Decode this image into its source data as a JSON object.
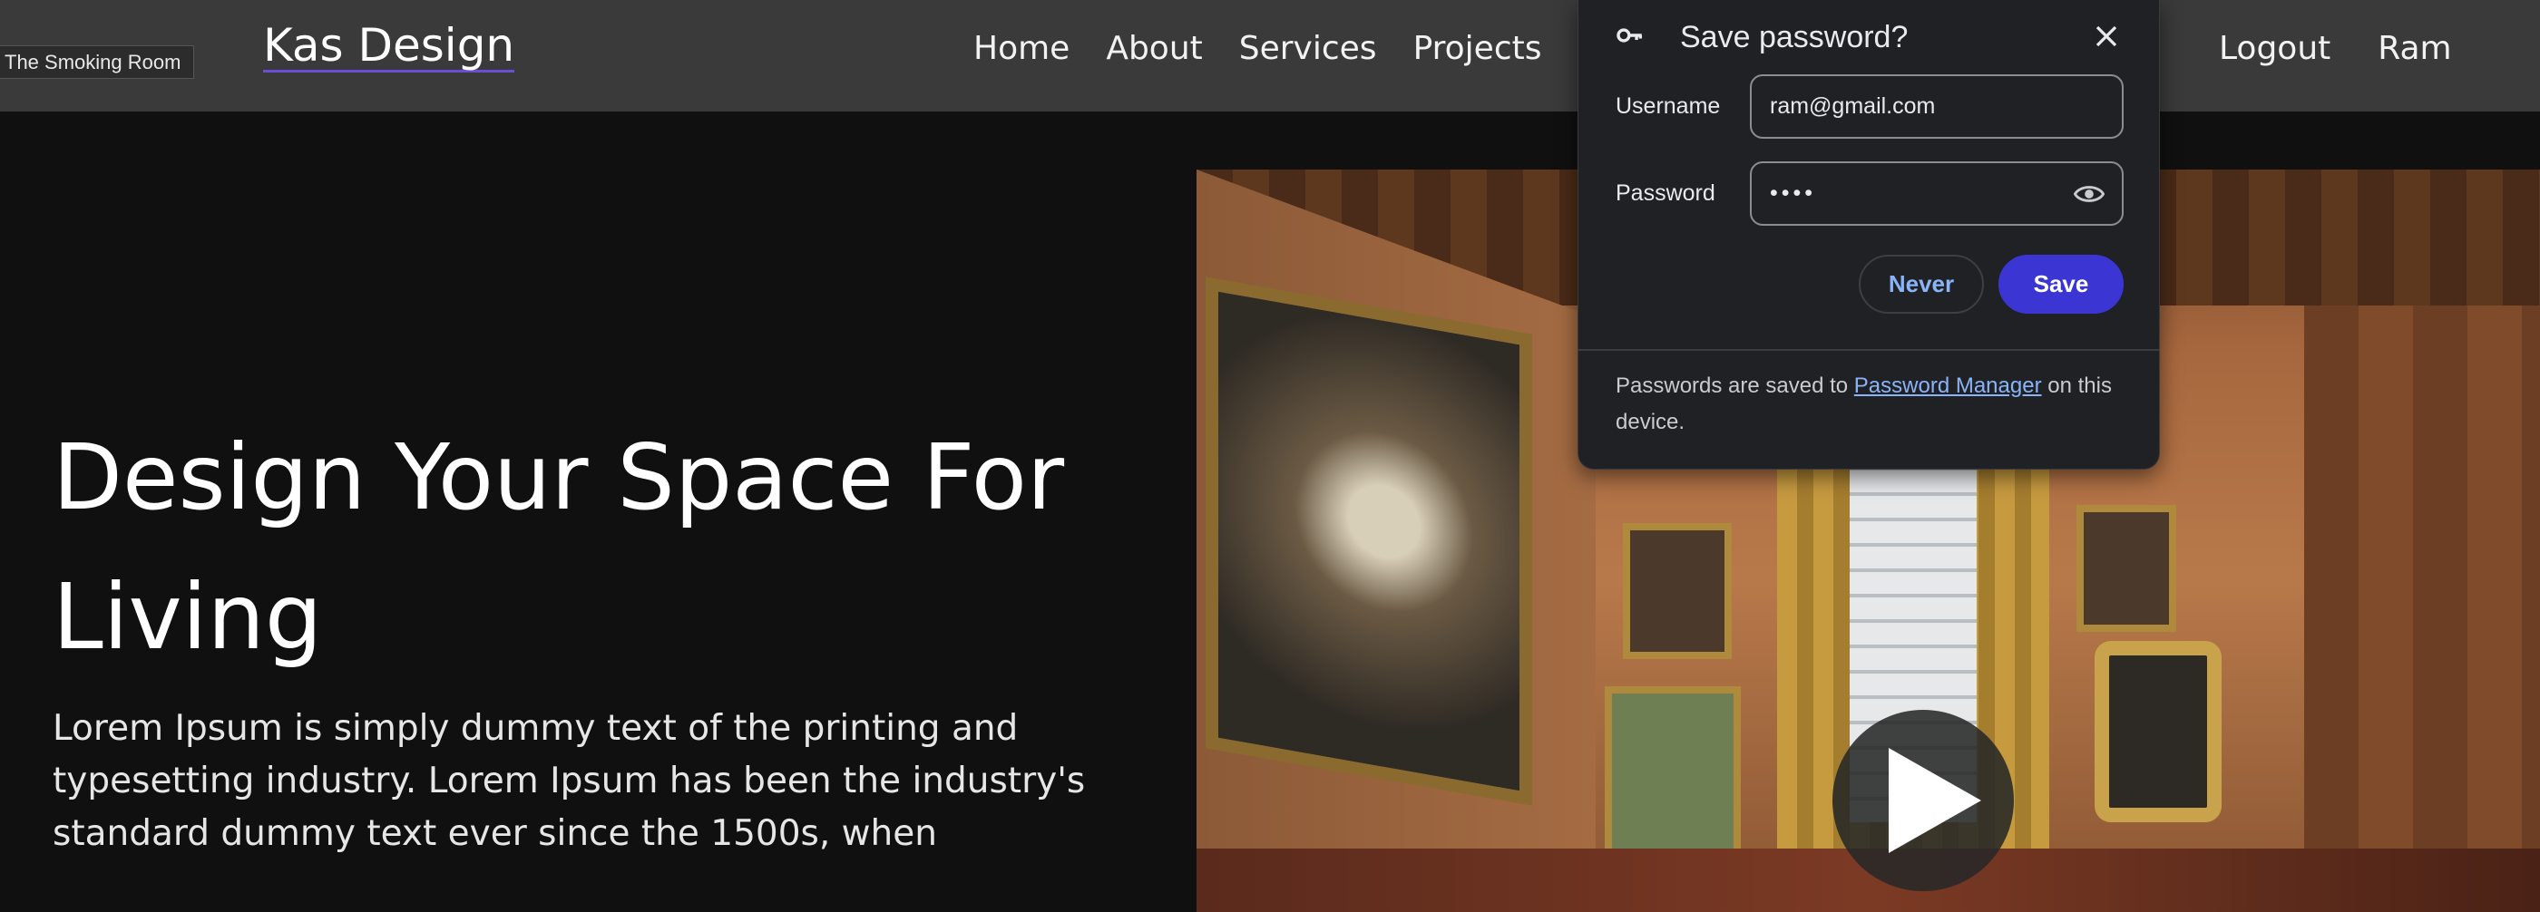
{
  "tooltip": {
    "text": "The Smoking Room"
  },
  "navbar": {
    "brand": "Kas Design",
    "links": [
      {
        "label": "Home"
      },
      {
        "label": "About"
      },
      {
        "label": "Services"
      },
      {
        "label": "Projects"
      }
    ],
    "right_links": [
      {
        "label": "Logout"
      },
      {
        "label": "Ram"
      }
    ]
  },
  "hero": {
    "title": "Design Your Space For Living",
    "text": "Lorem Ipsum is simply dummy text of the printing and typesetting industry. Lorem Ipsum has been the industry's standard dummy text ever since the 1500s, when"
  },
  "media": {
    "image_icon": "room-photo",
    "play_icon": "play-icon"
  },
  "password_dialog": {
    "title": "Save password?",
    "username_label": "Username",
    "username_value": "ram@gmail.com",
    "password_label": "Password",
    "password_value": "••••",
    "never_label": "Never",
    "save_label": "Save",
    "footer_prefix": "Passwords are saved to ",
    "footer_link": "Password Manager",
    "footer_suffix": " on this device.",
    "icons": {
      "key": "key-icon",
      "close": "close-icon",
      "eye": "eye-icon"
    }
  },
  "colors": {
    "navbar_bg": "#3a3a3a",
    "page_bg": "#101010",
    "dialog_bg": "#202124",
    "save_button": "#3b35d4",
    "link": "#8ab4f8",
    "brand_underline": "#6a4fd6"
  }
}
